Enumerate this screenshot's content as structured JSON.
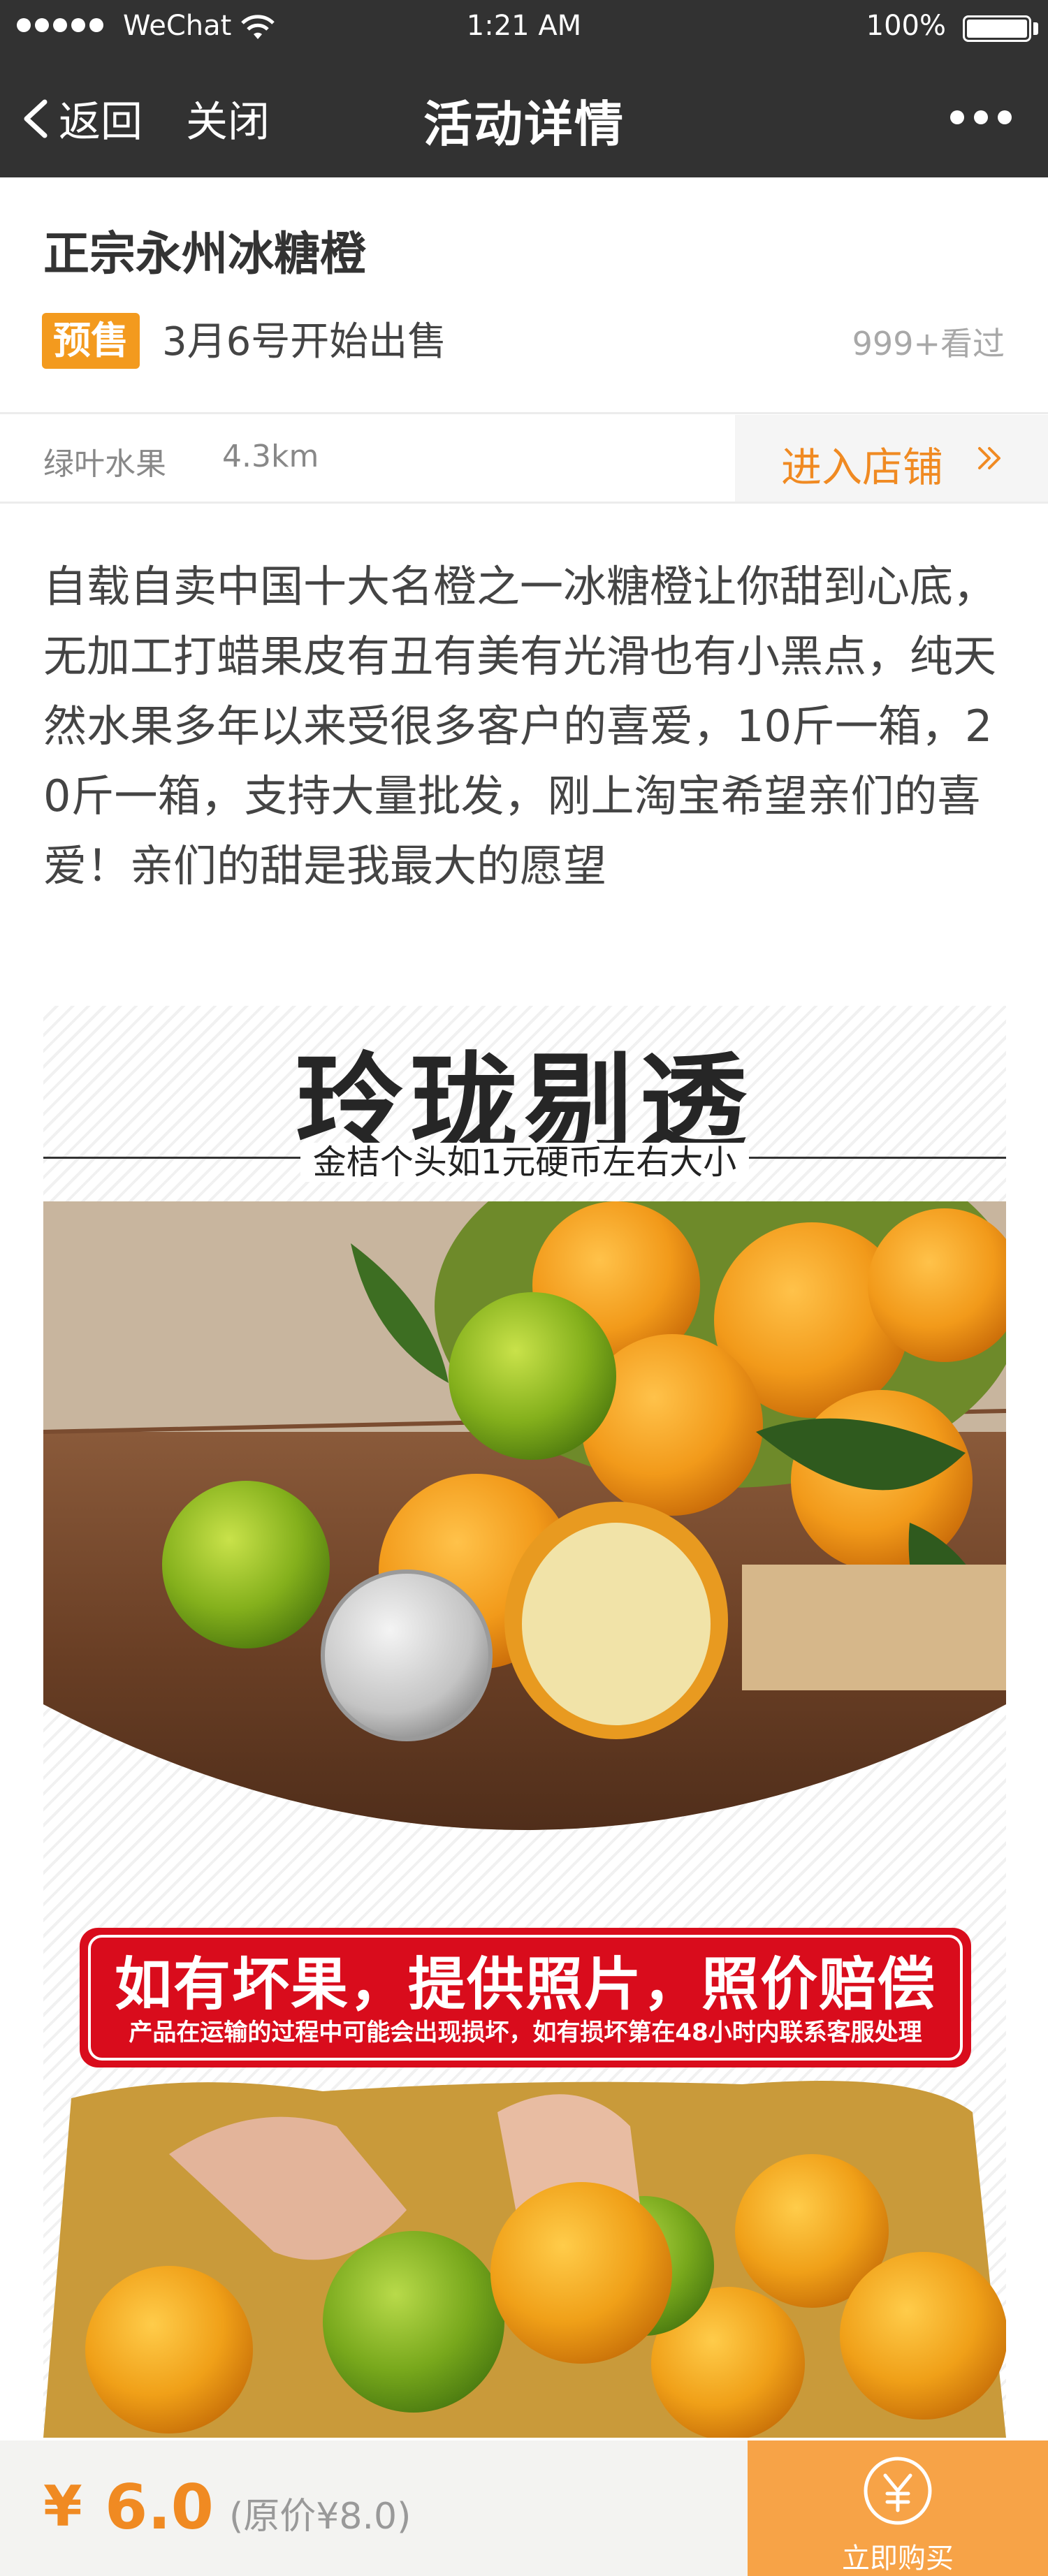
{
  "status_bar": {
    "carrier": "WeChat",
    "time": "1:21 AM",
    "battery": "100%"
  },
  "nav": {
    "back_label": "返回",
    "close_label": "关闭",
    "title": "活动详情"
  },
  "product": {
    "title": "正宗永州冰糖橙",
    "tag": "预售",
    "sale_date": "3月6号开始出售",
    "views": "999+看过"
  },
  "store": {
    "name": "绿叶水果",
    "distance": "4.3km",
    "enter_label": "进入店铺"
  },
  "description": "自载自卖中国十大名橙之一冰糖橙让你甜到心底，无加工打蜡果皮有丑有美有光滑也有小黑点，纯天然水果多年以来受很多客户的喜爱，10斤一箱，20斤一箱，支持大量批发，刚上淘宝希望亲们的喜爱！亲们的甜是我最大的愿望",
  "poster": {
    "headline": "玲珑剔透",
    "subheadline": "金桔个头如1元硬币左右大小",
    "banner_title": "如有坏果，提供照片，照价赔偿",
    "banner_note": "产品在运输的过程中可能会出现损坏，如有损坏第在48小时内联系客服处理"
  },
  "bottom_bar": {
    "currency": "¥",
    "price": "6.0",
    "original_price": "(原价¥8.0)",
    "buy_label": "立即购买"
  },
  "colors": {
    "nav_bg": "#323232",
    "accent_orange": "#f08a22",
    "tag_orange": "#f39a1e",
    "buy_button": "#f7a347",
    "banner_red": "#d90c1c"
  },
  "icons": [
    "signal-dots-icon",
    "wifi-icon",
    "battery-icon",
    "chevron-left-icon",
    "more-dots-icon",
    "double-chevron-right-icon",
    "yuan-circle-icon"
  ]
}
